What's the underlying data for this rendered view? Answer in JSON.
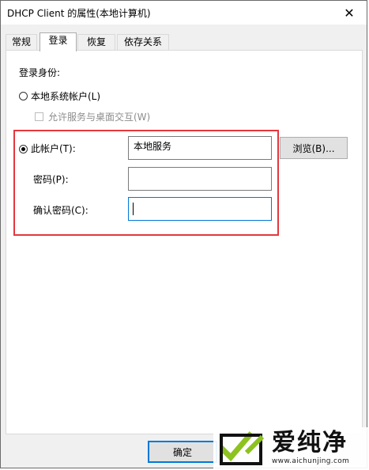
{
  "window": {
    "title": "DHCP Client 的属性(本地计算机)",
    "close_glyph": "✕"
  },
  "tabs": [
    {
      "label": "常规",
      "active": false
    },
    {
      "label": "登录",
      "active": true
    },
    {
      "label": "恢复",
      "active": false
    },
    {
      "label": "依存关系",
      "active": false
    }
  ],
  "logon": {
    "section_label": "登录身份:",
    "local_system": {
      "label": "本地系统帐户(L)",
      "selected": false
    },
    "interact_desktop": {
      "label": "允许服务与桌面交互(W)",
      "checked": false,
      "enabled": false
    },
    "this_account": {
      "label": "此帐户(T):",
      "selected": true,
      "value": "本地服务"
    },
    "browse_label": "浏览(B)...",
    "password": {
      "label": "密码(P):",
      "value": ""
    },
    "confirm_password": {
      "label": "确认密码(C):",
      "value": ""
    }
  },
  "footer": {
    "ok_label": "确定"
  },
  "watermark": {
    "title": "爱纯净",
    "url": "www.aichunjing.com",
    "accent_color": "#8dc21f"
  },
  "colors": {
    "highlight_border": "#e5373d",
    "focus_border": "#0078d7"
  }
}
